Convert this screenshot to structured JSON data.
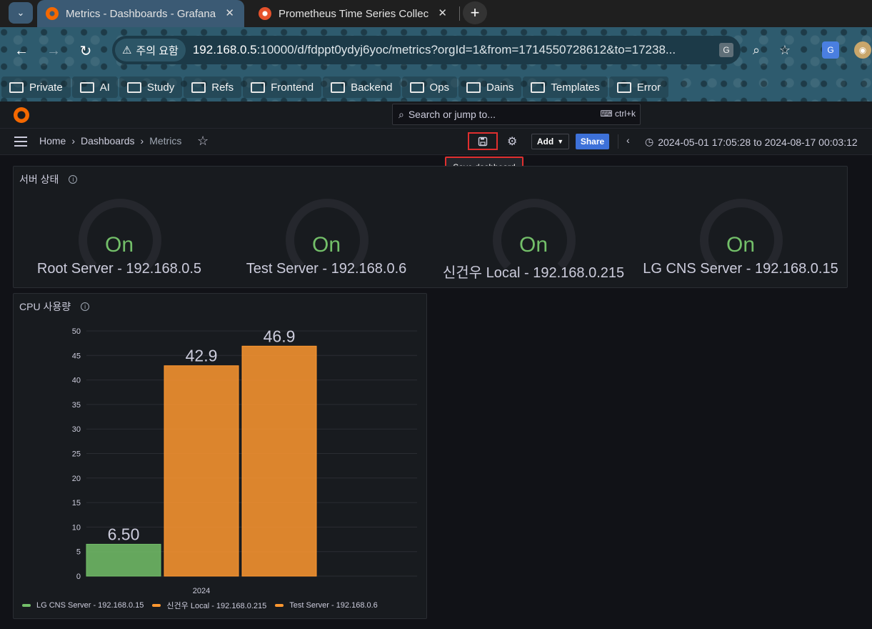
{
  "browser": {
    "tabs": [
      {
        "title": "Metrics - Dashboards - Grafana",
        "active": true
      },
      {
        "title": "Prometheus Time Series Collection",
        "active": false
      }
    ],
    "security_chip": "주의 요함",
    "url_host": "192.168.0.5",
    "url_rest": ":10000/d/fdppt0ydyj6yoc/metrics?orgId=1&from=1714550728612&to=17238...",
    "bookmarks": [
      "Private",
      "AI",
      "Study",
      "Refs",
      "Frontend",
      "Backend",
      "Ops",
      "Dains",
      "Templates",
      "Error"
    ]
  },
  "grafana": {
    "search_placeholder": "Search or jump to...",
    "search_shortcut": "ctrl+k",
    "breadcrumb": {
      "home": "Home",
      "dashboards": "Dashboards",
      "current": "Metrics"
    },
    "add_label": "Add",
    "share_label": "Share",
    "time_range": "2024-05-01 17:05:28 to 2024-08-17 00:03:12",
    "tooltip": "Save dashboard"
  },
  "server_panel": {
    "title": "서버 상태",
    "gauges": [
      {
        "value": "On",
        "label": "Root Server - 192.168.0.5"
      },
      {
        "value": "On",
        "label": "Test Server - 192.168.0.6"
      },
      {
        "value": "On",
        "label": "신건우 Local - 192.168.0.215"
      },
      {
        "value": "On",
        "label": "LG CNS Server - 192.168.0.15"
      }
    ]
  },
  "cpu_panel": {
    "title": "CPU 사용량"
  },
  "chart_data": {
    "type": "bar",
    "categories": [
      "2024"
    ],
    "series": [
      {
        "name": "LG CNS Server - 192.168.0.15",
        "values": [
          6.5
        ],
        "label": "6.50",
        "color": "#73bf69"
      },
      {
        "name": "신건우 Local - 192.168.0.215",
        "values": [
          42.9
        ],
        "label": "42.9",
        "color": "#ff9830"
      },
      {
        "name": "Test Server - 192.168.0.6",
        "values": [
          46.9
        ],
        "label": "46.9",
        "color": "#ff9830"
      }
    ],
    "yticks": [
      "0",
      "5",
      "10",
      "15",
      "20",
      "25",
      "30",
      "35",
      "40",
      "45",
      "50"
    ],
    "ylim": [
      0,
      50
    ],
    "title": "CPU 사용량",
    "legend": "bottom-left",
    "grid": true
  }
}
